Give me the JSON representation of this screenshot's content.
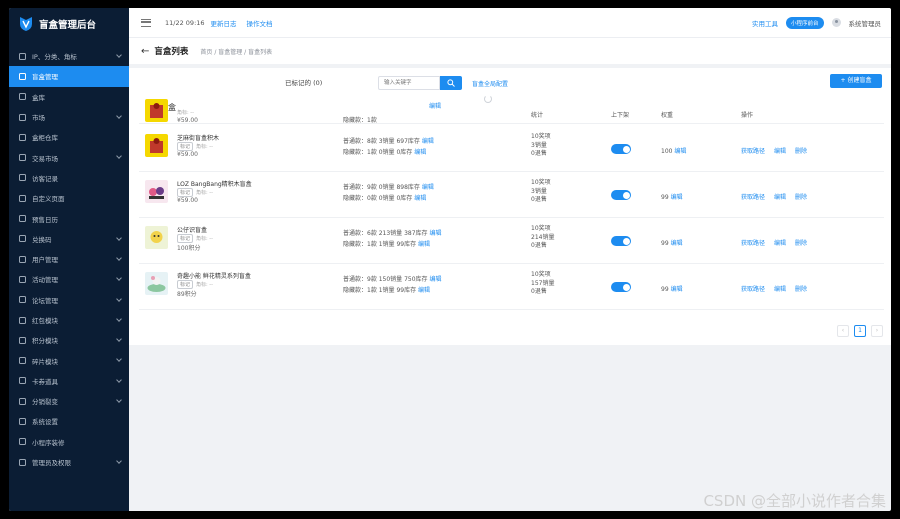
{
  "app": {
    "title": "盲盒管理后台"
  },
  "sidebar": {
    "items": [
      {
        "label": "IP、分类、角标",
        "icon": "grid-icon",
        "has_children": true
      },
      {
        "label": "盲盒管理",
        "icon": "box-icon",
        "active": true
      },
      {
        "label": "盒库",
        "icon": "list-icon"
      },
      {
        "label": "市场",
        "icon": "shop-icon",
        "has_children": true
      },
      {
        "label": "盒柜仓库",
        "icon": "warehouse-icon"
      },
      {
        "label": "交易市场",
        "icon": "trade-icon",
        "has_children": true
      },
      {
        "label": "访客记录",
        "icon": "visitor-icon"
      },
      {
        "label": "自定义页面",
        "icon": "page-icon"
      },
      {
        "label": "预售日历",
        "icon": "calendar-icon"
      },
      {
        "label": "兑换码",
        "icon": "code-icon",
        "has_children": true
      },
      {
        "label": "用户管理",
        "icon": "user-icon",
        "has_children": true
      },
      {
        "label": "活动管理",
        "icon": "activity-icon",
        "has_children": true
      },
      {
        "label": "论坛管理",
        "icon": "forum-icon",
        "has_children": true
      },
      {
        "label": "红包模块",
        "icon": "redpacket-icon",
        "has_children": true
      },
      {
        "label": "积分模块",
        "icon": "points-icon",
        "has_children": true
      },
      {
        "label": "碎片模块",
        "icon": "fragment-icon",
        "has_children": true
      },
      {
        "label": "卡券道具",
        "icon": "coupon-icon",
        "has_children": true
      },
      {
        "label": "分销裂变",
        "icon": "share-icon",
        "has_children": true
      },
      {
        "label": "系统设置",
        "icon": "wrench-icon"
      },
      {
        "label": "小程序装修",
        "icon": "gear-icon"
      },
      {
        "label": "管理员及权限",
        "icon": "admin-icon",
        "has_children": true
      }
    ]
  },
  "topbar": {
    "notice": "11/22 09:16",
    "changelog": "更新日志",
    "docs": "操作文档",
    "tools": "实用工具",
    "miniprogram": "小程序前台",
    "admin": "系统管理员"
  },
  "page": {
    "title": "盲盒列表",
    "breadcrumb": "首页 / 盲盒管理 / 盲盒列表"
  },
  "toolbar": {
    "tabs": [
      "",
      "",
      "",
      "已标记的 (0)"
    ],
    "search_placeholder": "输入关键字",
    "config_link": "盲盒全局配置",
    "create_button": "+ 创建盲盒"
  },
  "table": {
    "headers": {
      "name": "盒",
      "stock": "隐藏款：1款",
      "stats": "统计",
      "onoff": "上下架",
      "weight": "权重",
      "ops": "操作"
    },
    "rows": [
      {
        "name": "芝麻街盲盒积木",
        "tag": "标记",
        "tag_extra": "角标: --",
        "price": "¥59.00",
        "normal": "普通款：8款  3销量  697库存",
        "hidden": "隐藏款：1款  0销量  0库存",
        "stats": [
          "10奖项",
          "3销量",
          "0退售"
        ],
        "weight": "100",
        "edit": "编辑",
        "ops": [
          "获取路径",
          "编辑",
          "删除"
        ]
      },
      {
        "name": "LOZ BangBang精积木盲盒",
        "tag": "标记",
        "tag_extra": "角标: --",
        "price": "¥59.00",
        "normal": "普通款：9款  0销量  898库存",
        "hidden": "隐藏款：0款  0销量  0库存",
        "stats": [
          "10奖项",
          "3销量",
          "0退售"
        ],
        "weight": "99",
        "edit": "编辑",
        "ops": [
          "获取路径",
          "编辑",
          "删除"
        ]
      },
      {
        "name": "公仔识盲盒",
        "tag": "标记",
        "tag_extra": "角标: --",
        "price": "100积分",
        "normal": "普通款：6款  213销量  387库存",
        "hidden": "隐藏款：1款  1销量  99库存",
        "stats": [
          "10奖项",
          "214销量",
          "0退售"
        ],
        "weight": "99",
        "edit": "编辑",
        "ops": [
          "获取路径",
          "编辑",
          "删除"
        ]
      },
      {
        "name": "奇趣小能 鲜花精灵系列盲盒",
        "tag": "标记",
        "tag_extra": "角标: --",
        "price": "89积分",
        "normal": "普通款：9款  150销量  750库存",
        "hidden": "隐藏款：1款  1销量  99库存",
        "stats": [
          "10奖项",
          "157销量",
          "0退售"
        ],
        "weight": "99",
        "edit": "编辑",
        "ops": [
          "获取路径",
          "编辑",
          "删除"
        ]
      }
    ],
    "first_row": {
      "price": "¥59.00",
      "tag_extra": "角标: --",
      "edit": "编辑"
    }
  },
  "pagination": {
    "current": "1",
    "prev": "‹",
    "next": "›"
  },
  "watermark": "CSDN @全部小说作者合集"
}
